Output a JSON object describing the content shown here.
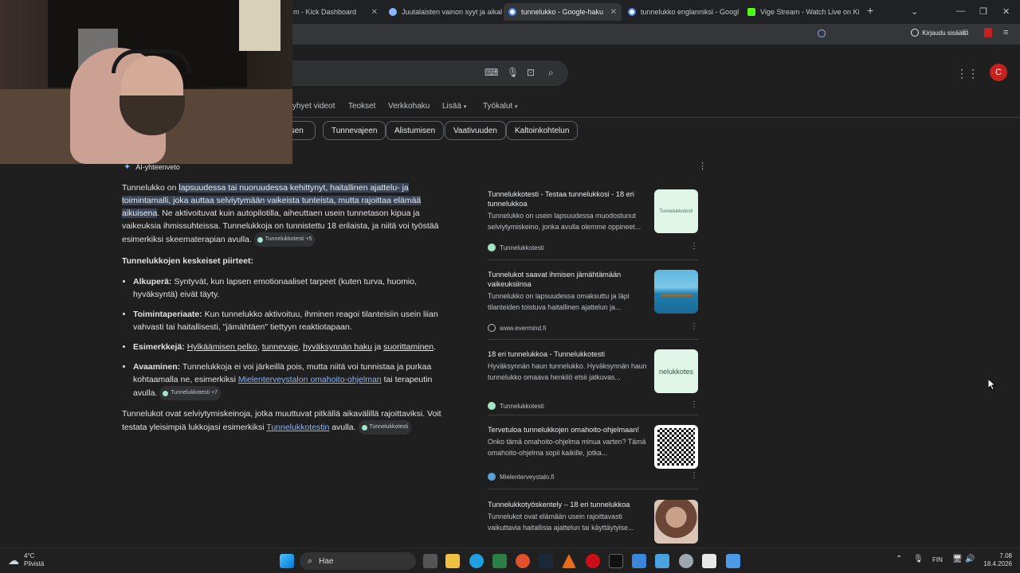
{
  "tabs": [
    {
      "label": "m - Kick Dashboard",
      "active": false
    },
    {
      "label": "Juutalaisten vainon syyt ja aikal",
      "active": false
    },
    {
      "label": "tunnelukko - Google-haku",
      "active": true
    },
    {
      "label": "tunnelukko englanniksi - Googl",
      "active": false
    },
    {
      "label": "Vige Stream - Watch Live on Ki",
      "active": false
    }
  ],
  "toolbar": {
    "signin_label": "Kirjaudu sisään"
  },
  "account": {
    "initial": "C"
  },
  "nav_tabs": [
    "yhyet videot",
    "Teokset",
    "Verkkohaku",
    "Lisää",
    "Työkalut"
  ],
  "chips": [
    "misen",
    "Tunnevajeen",
    "Alistumisen",
    "Vaativuuden",
    "Kaltoinkohtelun"
  ],
  "ai": {
    "header": "AI-yhteenveto",
    "intro_prefix": "Tunnelukko on ",
    "intro_highlight": "lapsuudessa tai nuoruudessa kehittynyt, haitallinen ajattelu- ja toimintamalli, joka auttaa selviytymään vaikeista tunteista, mutta rajoittaa elämää aikuisena",
    "intro_rest": ". Ne aktivoituvat kuin autopilotilla, aiheuttaen usein tunnetason kipua ja vaikeuksia ihmissuhteissa. Tunnelukkoja on tunnistettu 18 erilaista, ja niitä voi työstää esimerkiksi skeematerapian avulla.",
    "intro_source": "Tunnelukkotesti +5",
    "features_heading": "Tunnelukkojen keskeiset piirteet:",
    "bullets": [
      {
        "label": "Alkuperä:",
        "text": " Syntyvät, kun lapsen emotionaaliset tarpeet (kuten turva, huomio, hyväksyntä) eivät täyty."
      },
      {
        "label": "Toimintaperiaate:",
        "text": " Kun tunnelukko aktivoituu, ihminen reagoi tilanteisiin usein liian vahvasti tai haitallisesti, \"jämähtäen\" tiettyyn reaktiotapaan."
      },
      {
        "label": "Esimerkkejä:",
        "ex1": "Hylkäämisen pelko",
        "sep1": ", ",
        "ex2": "tunnevaje",
        "sep2": ", ",
        "ex3": "hyväksynnän haku",
        "sep3": " ja ",
        "ex4": "suorittaminen",
        "end": "."
      },
      {
        "label": "Avaaminen:",
        "text_a": " Tunnelukkoja ei voi järkeillä pois, mutta niitä voi tunnistaa ja purkaa kohtaamalla ne, esimerkiksi ",
        "link": "Mielenterveystalon omahoito-ohjelman",
        "text_b": " tai terapeutin avulla.",
        "source": "Tunnelukkotesti +7"
      }
    ],
    "closing_a": "Tunnelukot ovat selviytymiskeinoja, jotka muuttuvat pitkällä aikavälillä rajoittaviksi. Voit testata yleisimpiä lukkojasi esimerkiksi ",
    "closing_link": "Tunnelukkotestin",
    "closing_b": " avulla.",
    "closing_source": "Tunnelukkotesti"
  },
  "sources": [
    {
      "title": "Tunnelukkotesti - Testaa tunnelukkosi - 18 eri tunnelukkoa",
      "snippet": "Tunnelukko on usein lapsuudessa muodostunut selviytymiskeino, jonka avulla olemme oppineet...",
      "site": "Tunnelukkotesti",
      "thumb": "text",
      "thumb_text": "Tunnelukkotesti"
    },
    {
      "title": "Tunnelukot saavat ihmisen jämähtämään vaikeuksiinsa",
      "snippet": "Tunnelukko on lapsuudessa omaksuttu ja läpi tilanteiden toistuva haitallinen ajattelun ja...",
      "site": "www.evermind.fi",
      "thumb": "sea",
      "thumb_text": ""
    },
    {
      "title": "18 eri tunnelukkoa - Tunnelukkotesti",
      "snippet": "Hyväksynnän haun tunnelukko. Hyväksynnän haun tunnelukko omaava henkilö etsii jatkuvas...",
      "site": "Tunnelukkotesti",
      "thumb": "text",
      "thumb_text": "nelukkotes"
    },
    {
      "title": "Tervetuloa tunnelukkojen omahoito-ohjelmaan!",
      "snippet": "Onko tämä omahoito-ohjelma minua varten? Tämä omahoito-ohjelma sopii kaikille, jotka...",
      "site": "Mielenterveystalo.fi",
      "thumb": "qr",
      "thumb_text": ""
    },
    {
      "title": "Tunnelukkotyöskentely – 18 eri tunnelukkoa",
      "snippet": "Tunnelukot ovat elämään usein rajoittavasti vaikuttavia haitallisia ajattelun tai käyttäytyise...",
      "site": "",
      "thumb": "face",
      "thumb_text": ""
    }
  ],
  "taskbar": {
    "weather_temp": "4°C",
    "weather_desc": "Pilvistä",
    "search_label": "Hae",
    "lang": "FIN",
    "time": "7.08",
    "date": "18.4.2026"
  },
  "colors": {
    "accent": "#8ab4f8",
    "highlight": "#394457",
    "avatar": "#c5221f"
  }
}
